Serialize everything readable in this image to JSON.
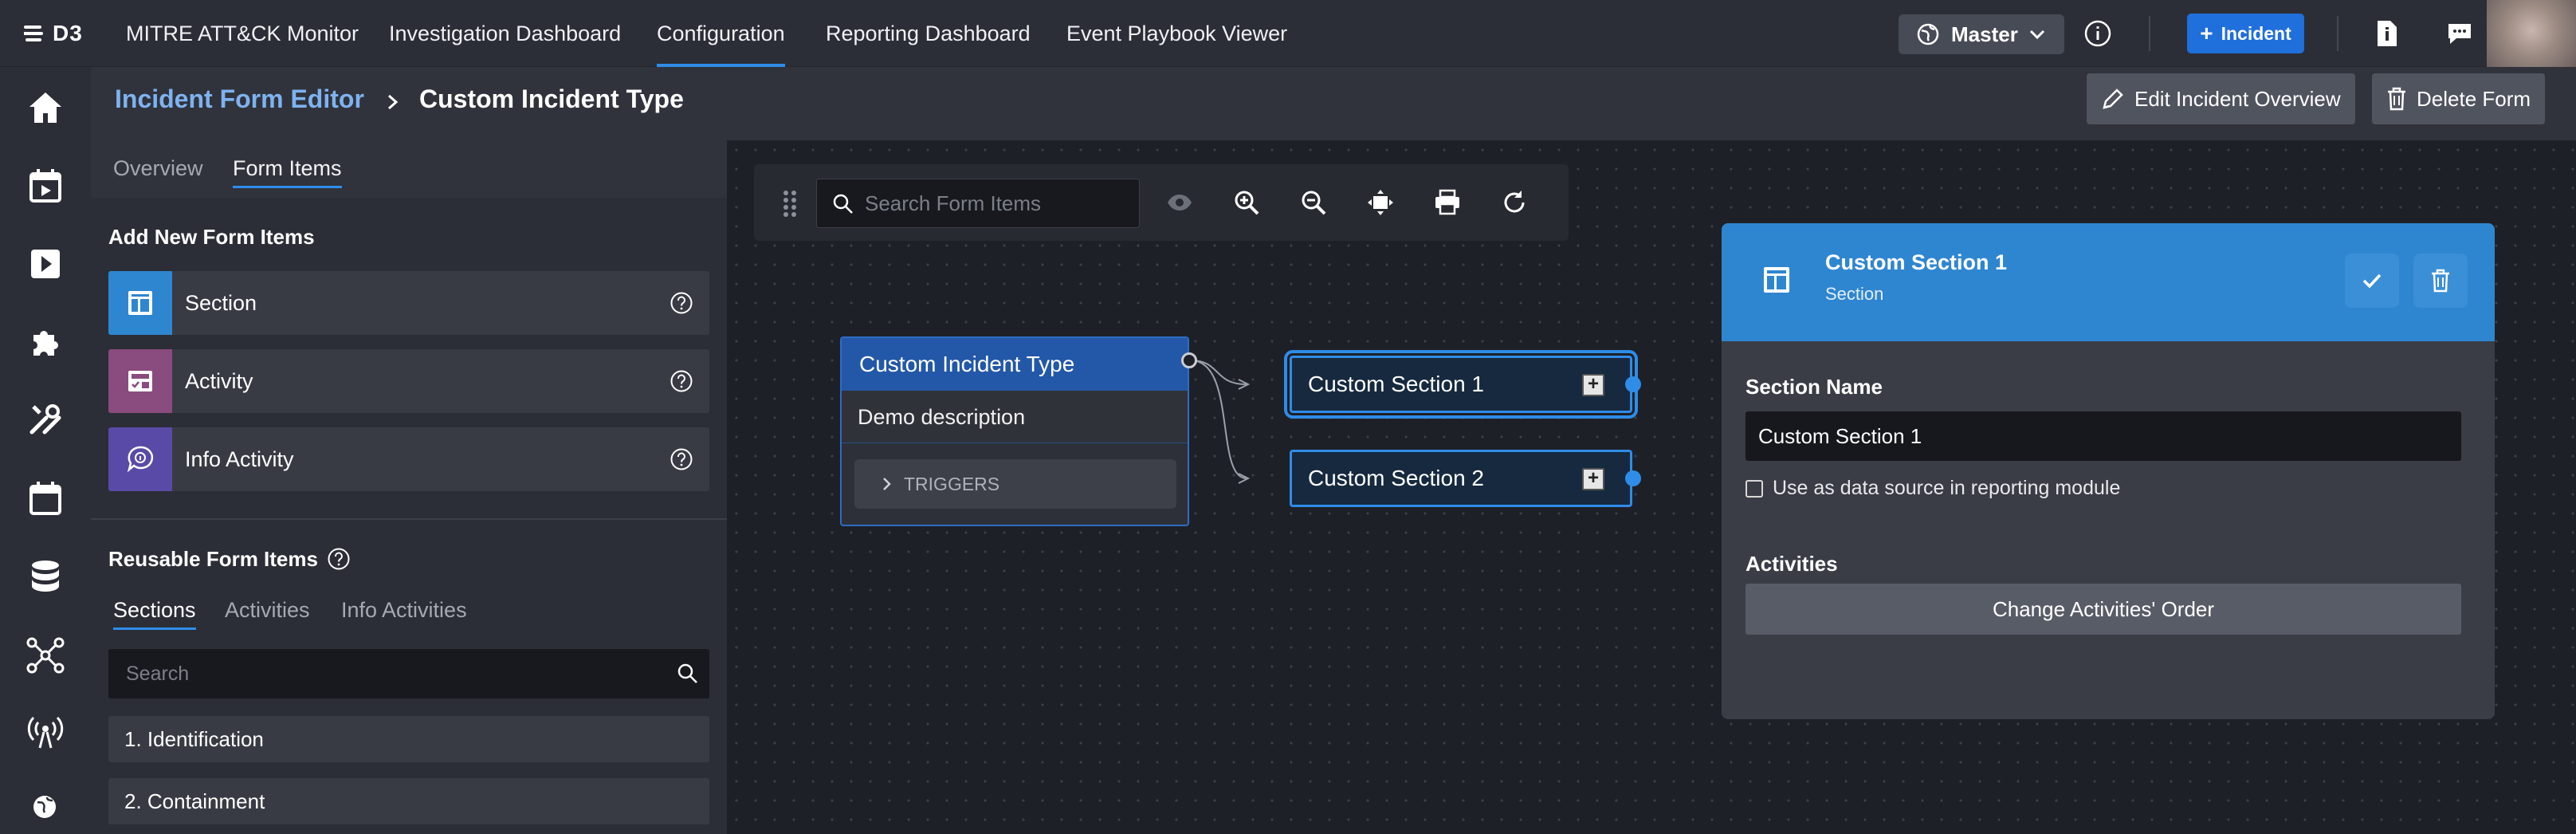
{
  "app": {
    "logo_text": "D3"
  },
  "nav": {
    "links": [
      "MITRE ATT&CK Monitor",
      "Investigation Dashboard",
      "Configuration",
      "Reporting Dashboard",
      "Event Playbook Viewer"
    ],
    "active": "Configuration",
    "branch_label": "Master",
    "incident_button": "Incident"
  },
  "rail": {
    "icons": [
      "home-icon",
      "calendar-play-icon",
      "playbook-icon",
      "integrations-icon",
      "tools-icon",
      "calendar-icon",
      "database-icon",
      "network-icon",
      "broadcast-icon",
      "globe-icon"
    ]
  },
  "header": {
    "breadcrumb_parent": "Incident Form Editor",
    "breadcrumb_current": "Custom Incident Type",
    "edit_button": "Edit Incident Overview",
    "delete_button": "Delete Form"
  },
  "left_panel": {
    "tabs": [
      "Overview",
      "Form Items"
    ],
    "active_tab": "Form Items",
    "add_title": "Add New Form Items",
    "add_items": [
      {
        "label": "Section",
        "icon": "section-icon",
        "color": "#2f86d0"
      },
      {
        "label": "Activity",
        "icon": "activity-icon",
        "color": "#8a4b7e"
      },
      {
        "label": "Info Activity",
        "icon": "info-activity-icon",
        "color": "#5a4aa8"
      }
    ],
    "reusable_title": "Reusable Form Items",
    "reusable_tabs": [
      "Sections",
      "Activities",
      "Info Activities"
    ],
    "reusable_active": "Sections",
    "search_placeholder": "Search",
    "reusable_items": [
      "1. Identification",
      "2. Containment"
    ]
  },
  "canvas": {
    "search_placeholder": "Search Form Items",
    "tools": [
      "eye-icon",
      "zoom-in-icon",
      "zoom-out-icon",
      "fit-icon",
      "print-icon",
      "refresh-icon"
    ],
    "incident_node": {
      "title": "Custom Incident Type",
      "description": "Demo description",
      "triggers_label": "TRIGGERS"
    },
    "sections": [
      "Custom Section 1",
      "Custom Section 2"
    ],
    "selected_section": "Custom Section 1"
  },
  "props": {
    "title": "Custom Section 1",
    "subtitle": "Section",
    "name_label": "Section Name",
    "name_value": "Custom Section 1",
    "checkbox_label": "Use as data source in reporting module",
    "checkbox_checked": false,
    "activities_label": "Activities",
    "order_button": "Change Activities' Order"
  }
}
